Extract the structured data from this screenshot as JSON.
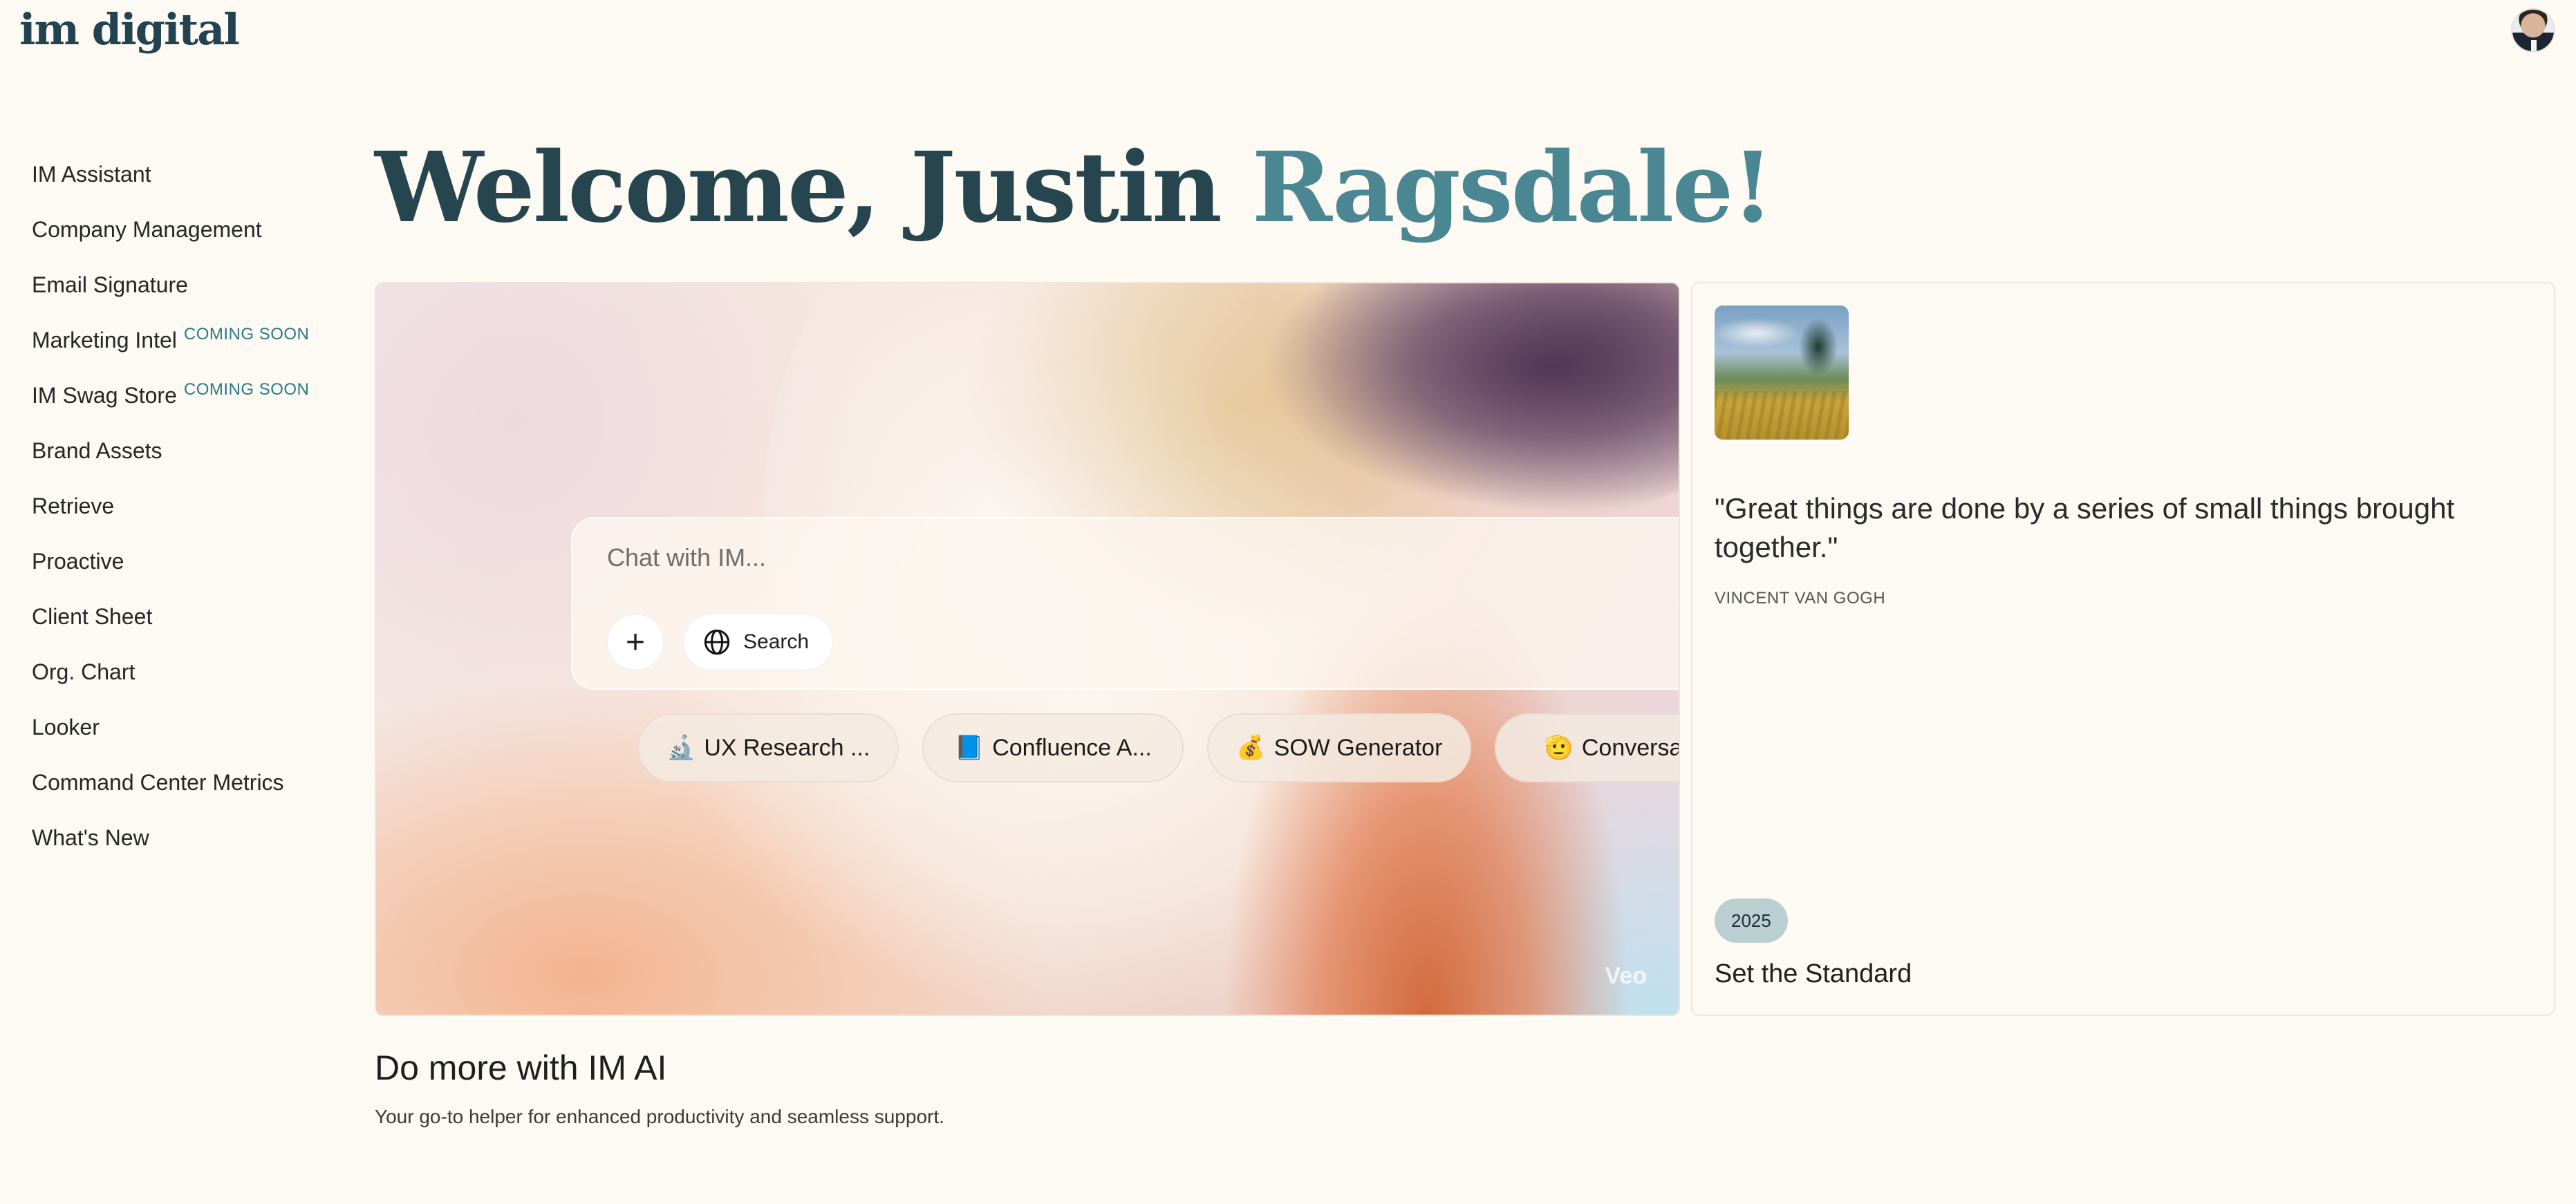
{
  "header": {
    "logo_text": "im digital",
    "avatar_label": "user avatar"
  },
  "sidebar": {
    "items": [
      {
        "label": "IM Assistant",
        "badge": ""
      },
      {
        "label": "Company Management",
        "badge": ""
      },
      {
        "label": "Email Signature",
        "badge": ""
      },
      {
        "label": "Marketing Intel",
        "badge": "COMING SOON"
      },
      {
        "label": "IM Swag Store",
        "badge": "COMING SOON"
      },
      {
        "label": "Brand Assets",
        "badge": ""
      },
      {
        "label": "Retrieve",
        "badge": ""
      },
      {
        "label": "Proactive",
        "badge": ""
      },
      {
        "label": "Client Sheet",
        "badge": ""
      },
      {
        "label": "Org. Chart",
        "badge": ""
      },
      {
        "label": "Looker",
        "badge": ""
      },
      {
        "label": "Command Center Metrics",
        "badge": ""
      },
      {
        "label": "What's New",
        "badge": ""
      }
    ]
  },
  "welcome": {
    "part1": "Welcome, Justin ",
    "part2": "Ragsdale!"
  },
  "chat": {
    "placeholder": "Chat with IM...",
    "plus_label": "+",
    "search_label": "Search"
  },
  "chips": [
    {
      "icon": "🔬",
      "label": "UX Research ..."
    },
    {
      "icon": "📘",
      "label": "Confluence A..."
    },
    {
      "icon": "💰",
      "label": "SOW Generator"
    },
    {
      "icon": "🫡",
      "label": "Conversatio"
    }
  ],
  "hero": {
    "watermark": "Veo"
  },
  "quote": {
    "text": "\"Great things are done by a series of small things brought together.\"",
    "author": "VINCENT VAN GOGH",
    "year": "2025",
    "theme": "Set the Standard"
  },
  "section": {
    "title": "Do more with IM AI",
    "subtitle": "Your go-to helper for enhanced productivity and seamless support."
  },
  "colors": {
    "background": "#fdf9f3",
    "brand": "#22434f",
    "accent": "#4a8792",
    "coming_soon": "#2a7a86"
  }
}
